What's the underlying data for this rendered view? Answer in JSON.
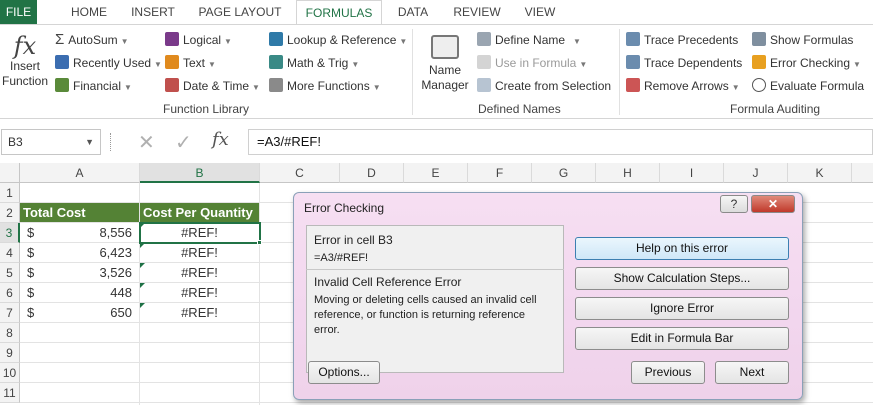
{
  "tabs": {
    "file": "FILE",
    "home": "HOME",
    "insert": "INSERT",
    "page_layout": "PAGE LAYOUT",
    "formulas": "FORMULAS",
    "data": "DATA",
    "review": "REVIEW",
    "view": "VIEW"
  },
  "ribbon": {
    "insert_function_line1": "Insert",
    "insert_function_line2": "Function",
    "autosum": "AutoSum",
    "recently_used": "Recently Used",
    "financial": "Financial",
    "logical": "Logical",
    "text": "Text",
    "date_time": "Date & Time",
    "lookup_reference": "Lookup & Reference",
    "math_trig": "Math & Trig",
    "more_functions": "More Functions",
    "function_library_label": "Function Library",
    "name_manager_line1": "Name",
    "name_manager_line2": "Manager",
    "define_name": "Define Name",
    "use_in_formula": "Use in Formula",
    "create_from_selection": "Create from Selection",
    "defined_names_label": "Defined Names",
    "trace_precedents": "Trace Precedents",
    "trace_dependents": "Trace Dependents",
    "remove_arrows": "Remove Arrows",
    "show_formulas": "Show Formulas",
    "error_checking": "Error Checking",
    "evaluate_formula": "Evaluate Formula",
    "formula_auditing_label": "Formula Auditing"
  },
  "formula_bar": {
    "name_box": "B3",
    "formula": "=A3/#REF!"
  },
  "columns": [
    "A",
    "B",
    "C",
    "D",
    "E",
    "F",
    "G",
    "H",
    "I",
    "J",
    "K"
  ],
  "rows": [
    "1",
    "2",
    "3",
    "4",
    "5",
    "6",
    "7",
    "8",
    "9",
    "10",
    "11"
  ],
  "sheet": {
    "header_a": "Total Cost",
    "header_b": "Cost Per Quantity",
    "currency": "$",
    "values": [
      "8,556",
      "6,423",
      "3,526",
      "448",
      "650"
    ],
    "ref_error": "#REF!"
  },
  "dialog": {
    "title": "Error Checking",
    "help_glyph": "?",
    "close_glyph": "✕",
    "error_in_cell": "Error in cell B3",
    "formula": "=A3/#REF!",
    "error_type": "Invalid Cell Reference Error",
    "description": "Moving or deleting cells caused an invalid cell reference, or function is returning reference error.",
    "help_button": "Help on this error",
    "calc_steps_button": "Show Calculation Steps...",
    "ignore_button": "Ignore Error",
    "edit_button": "Edit in Formula Bar",
    "options_button": "Options...",
    "previous_button": "Previous",
    "next_button": "Next"
  },
  "colors": {
    "accent": "#217346",
    "header_fill": "#548235",
    "dialog_bg": "#f2d6ee"
  }
}
